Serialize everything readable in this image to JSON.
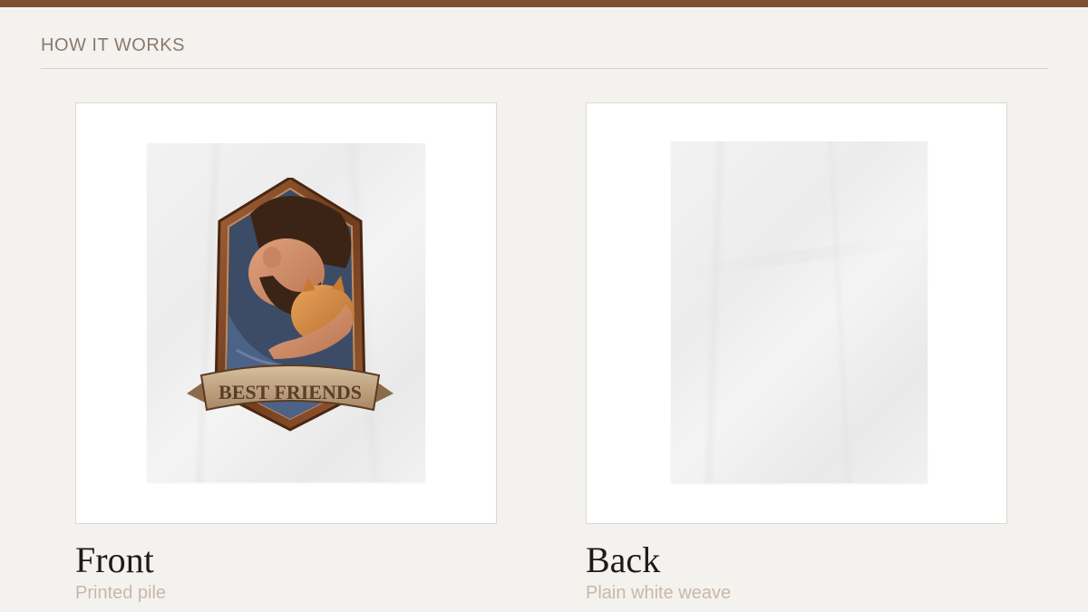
{
  "section": {
    "title": "HOW IT WORKS"
  },
  "colors": {
    "accent_bar": "#7b5236",
    "background": "#f4f2ee",
    "subtitle": "#c8b8ab"
  },
  "cards": [
    {
      "title": "Front",
      "subtitle": "Printed pile",
      "image": {
        "kind": "blanket-with-emblem",
        "banner_text": "BEST FRIENDS"
      }
    },
    {
      "title": "Back",
      "subtitle": "Plain white weave",
      "image": {
        "kind": "plain-white-blanket"
      }
    }
  ]
}
